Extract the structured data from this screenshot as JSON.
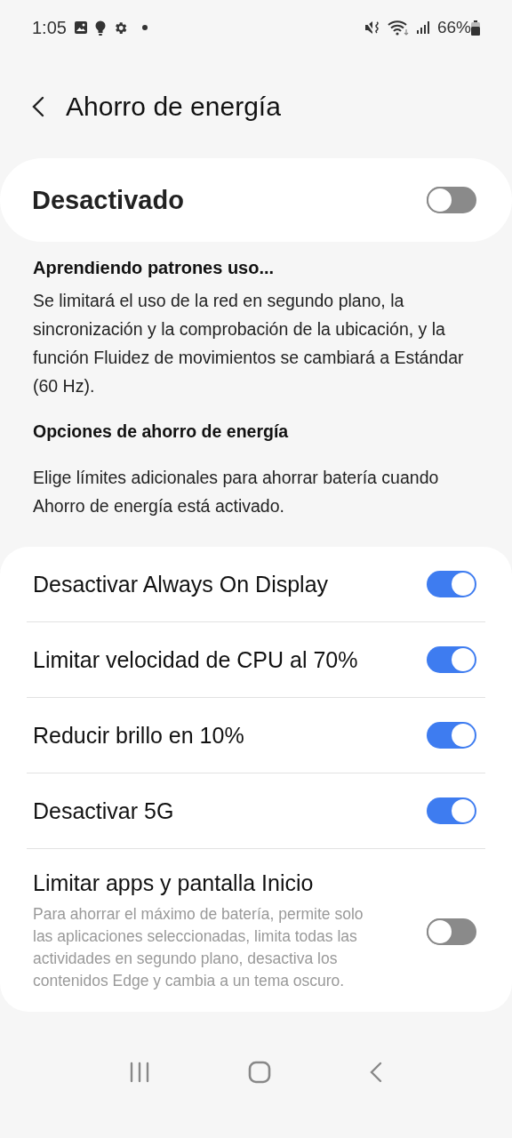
{
  "status_bar": {
    "time": "1:05",
    "battery": "66%"
  },
  "header": {
    "title": "Ahorro de energía"
  },
  "master": {
    "label": "Desactivado",
    "on": false
  },
  "learning": "Aprendiendo patrones uso...",
  "description": "Se limitará el uso de la red en segundo plano, la sincronización y la comprobación de la ubicación, y la función Fluidez de movimientos se cambiará a Estándar (60 Hz).",
  "options_heading": "Opciones de ahorro de energía",
  "options_description": "Elige límites adicionales para ahorrar batería cuando Ahorro de energía está activado.",
  "options": [
    {
      "label": "Desactivar Always On Display",
      "on": true
    },
    {
      "label": "Limitar velocidad de CPU al 70%",
      "on": true
    },
    {
      "label": "Reducir brillo en 10%",
      "on": true
    },
    {
      "label": "Desactivar 5G",
      "on": true
    },
    {
      "label": "Limitar apps y pantalla Inicio",
      "summary": "Para ahorrar el máximo de batería, permite solo las aplicaciones seleccionadas, limita todas las actividades en segundo plano, desactiva los contenidos Edge y cambia a un tema oscuro.",
      "on": false
    }
  ]
}
